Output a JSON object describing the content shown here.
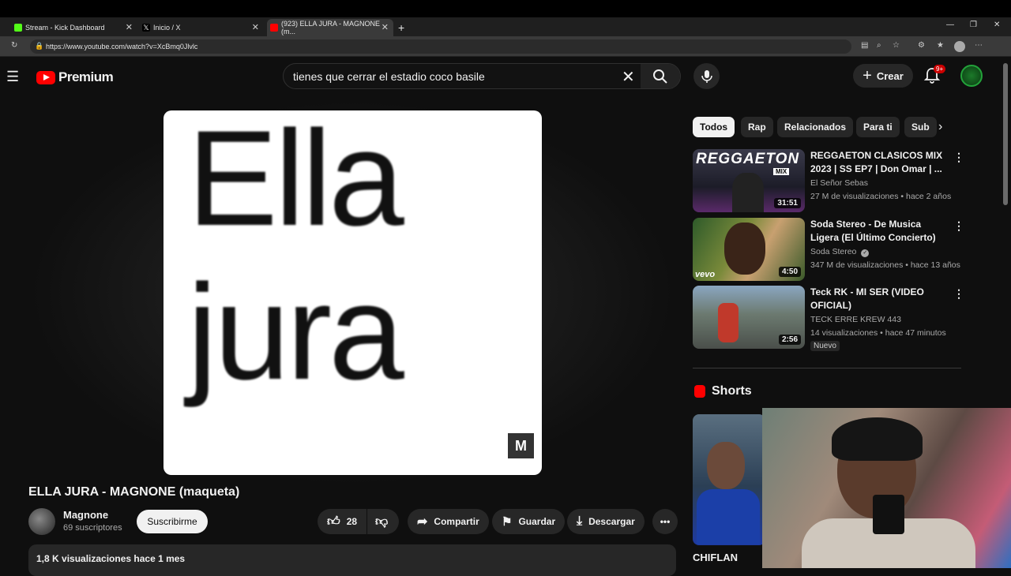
{
  "browser": {
    "tabs": [
      {
        "title": "Stream - Kick Dashboard",
        "favicon": "kick-icon",
        "color": "#53fc18"
      },
      {
        "title": "Inicio / X",
        "favicon": "x-icon",
        "color": "#ffffff"
      },
      {
        "title": "(923) ELLA JURA - MAGNONE (m...",
        "favicon": "youtube-icon",
        "color": "#ff0000"
      }
    ],
    "url": "https://www.youtube.com/watch?v=XcBmq0Jlvlc"
  },
  "header": {
    "logo_text": "Premium",
    "search_value": "tienes que cerrar el estadio coco basile",
    "create_label": "Crear",
    "notif_count": "9+"
  },
  "video": {
    "frame_line1": "Ella",
    "frame_line2": "jura",
    "watermark": "M",
    "title": "ELLA JURA - MAGNONE (maqueta)",
    "channel": "Magnone",
    "subscribers": "69 suscriptores",
    "subscribe_label": "Suscribirme",
    "likes": "28",
    "share_label": "Compartir",
    "save_label": "Guardar",
    "download_label": "Descargar",
    "views_date": "1,8 K visualizaciones  hace 1 mes"
  },
  "chips": [
    "Todos",
    "Rap",
    "Relacionados",
    "Para ti",
    "Sub"
  ],
  "recommendations": [
    {
      "title": "REGGAETON CLASICOS MIX 2023 | SS EP7 | Don Omar | ...",
      "channel": "El Señor Sebas",
      "meta": "27 M de visualizaciones • hace 2 años",
      "duration": "31:51",
      "thumb_text": "REGGAETON",
      "thumb_sub": "MIX"
    },
    {
      "title": "Soda Stereo - De Musica Ligera (El Último Concierto)",
      "channel": "Soda Stereo",
      "meta": "347 M de visualizaciones • hace 13 años",
      "duration": "4:50",
      "thumb_text": "vevo"
    },
    {
      "title": "Teck RK - MI SER (VIDEO OFICIAL)",
      "channel": "TECK ERRE KREW 443",
      "meta": "14 visualizaciones • hace 47 minutos",
      "duration": "2:56",
      "badge": "Nuevo"
    }
  ],
  "shorts": {
    "heading": "Shorts",
    "first_title": "CHIFLAN"
  }
}
